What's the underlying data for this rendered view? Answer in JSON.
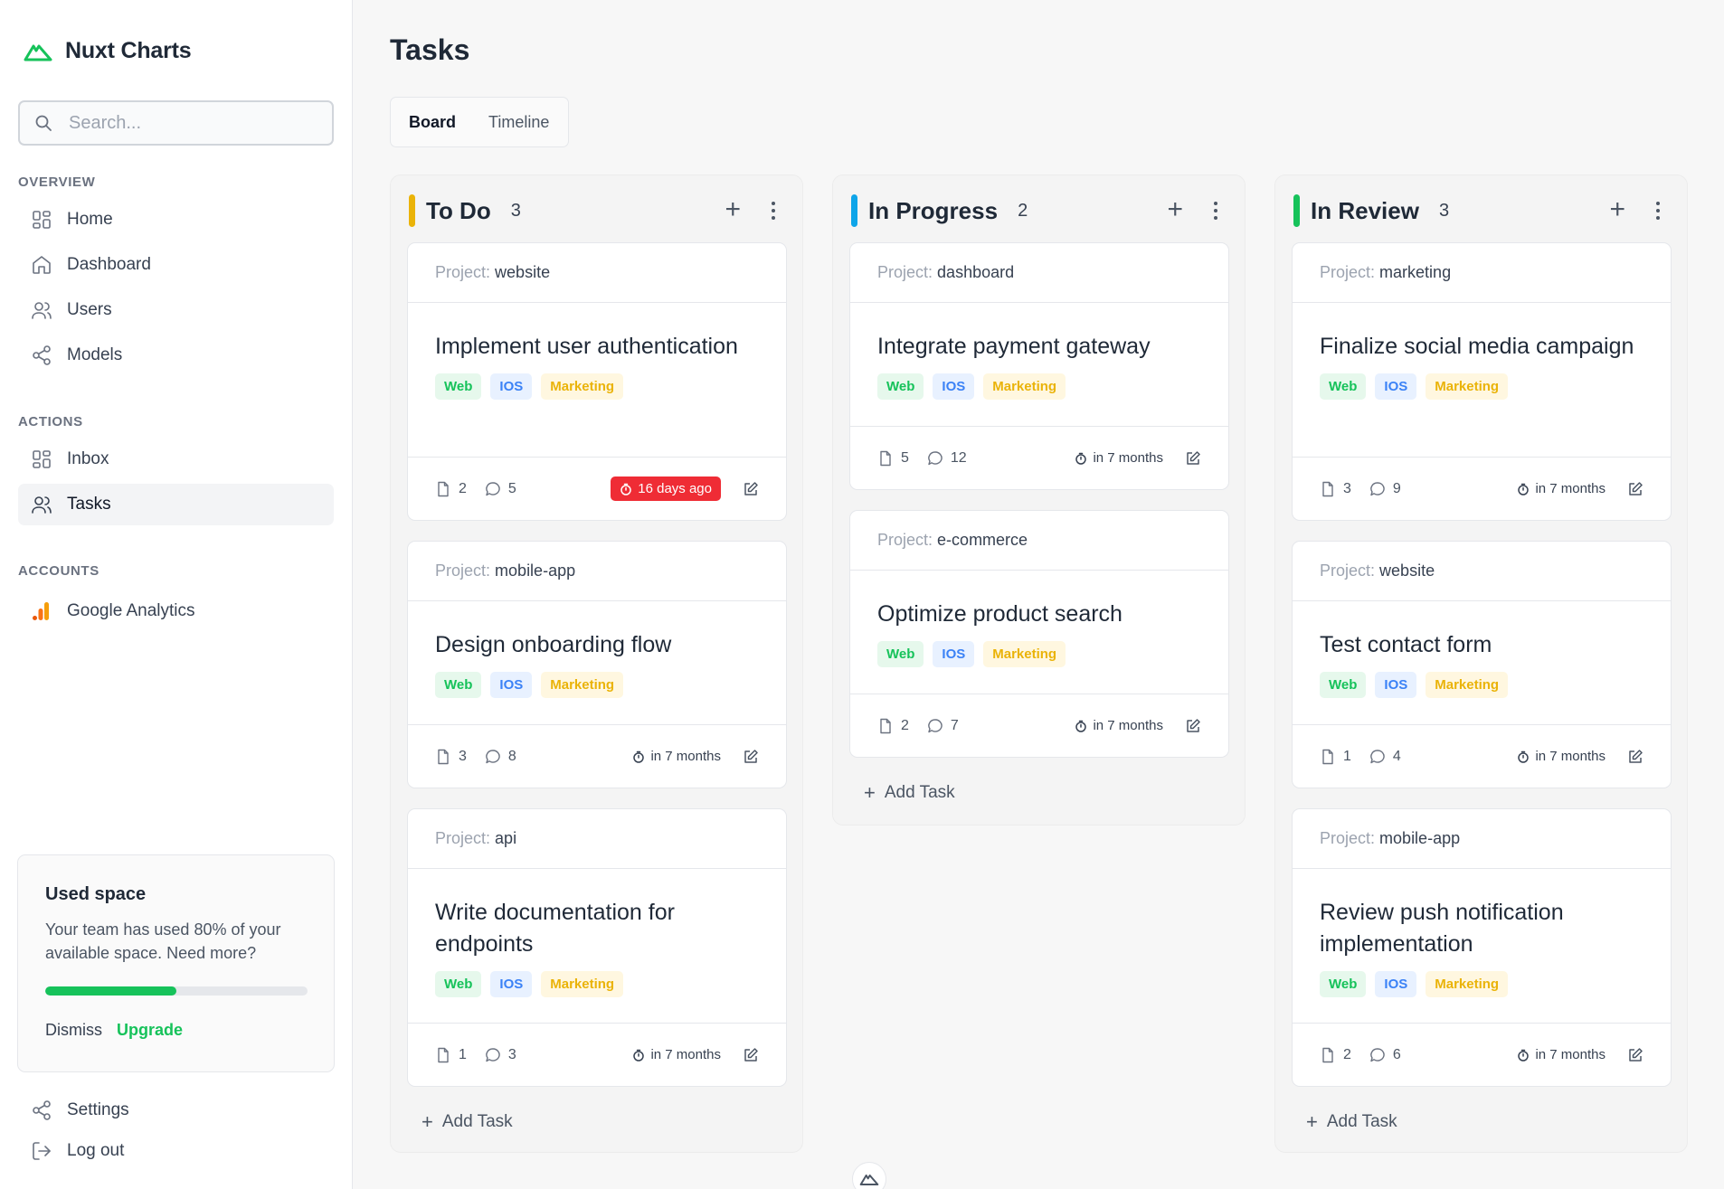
{
  "app": {
    "name": "Nuxt Charts"
  },
  "search": {
    "placeholder": "Search..."
  },
  "sidebar": {
    "overview_label": "OVERVIEW",
    "overview": [
      {
        "label": "Home",
        "icon": "grid-icon"
      },
      {
        "label": "Dashboard",
        "icon": "house-icon"
      },
      {
        "label": "Users",
        "icon": "users-icon"
      },
      {
        "label": "Models",
        "icon": "share-icon"
      }
    ],
    "actions_label": "ACTIONS",
    "actions": [
      {
        "label": "Inbox",
        "icon": "grid-icon"
      },
      {
        "label": "Tasks",
        "icon": "users-icon",
        "active": true
      }
    ],
    "accounts_label": "ACCOUNTS",
    "accounts": [
      {
        "label": "Google Analytics",
        "icon": "analytics-icon"
      }
    ],
    "usage": {
      "title": "Used space",
      "text": "Your team has used 80% of your available space. Need more?",
      "percent": 50,
      "dismiss": "Dismiss",
      "upgrade": "Upgrade"
    },
    "footer": [
      {
        "label": "Settings",
        "icon": "share-icon"
      },
      {
        "label": "Log out",
        "icon": "logout-icon"
      }
    ]
  },
  "page": {
    "title": "Tasks",
    "tabs": [
      {
        "label": "Board",
        "active": true
      },
      {
        "label": "Timeline"
      }
    ]
  },
  "board": {
    "project_prefix": "Project:",
    "add_task": "Add Task",
    "columns": [
      {
        "title": "To Do",
        "count": "3",
        "color": "#eab308",
        "cards": [
          {
            "project": "website",
            "title": "Implement user authentication",
            "tags": [
              "Web",
              "IOS",
              "Marketing"
            ],
            "files": "2",
            "comments": "5",
            "due": "16 days ago",
            "overdue": true
          },
          {
            "project": "mobile-app",
            "title": "Design onboarding flow",
            "tags": [
              "Web",
              "IOS",
              "Marketing"
            ],
            "files": "3",
            "comments": "8",
            "due": "in 7 months"
          },
          {
            "project": "api",
            "title": "Write documentation for endpoints",
            "tags": [
              "Web",
              "IOS",
              "Marketing"
            ],
            "files": "1",
            "comments": "3",
            "due": "in 7 months"
          }
        ]
      },
      {
        "title": "In Progress",
        "count": "2",
        "color": "#0ea5e9",
        "cards": [
          {
            "project": "dashboard",
            "title": "Integrate payment gateway",
            "tags": [
              "Web",
              "IOS",
              "Marketing"
            ],
            "files": "5",
            "comments": "12",
            "due": "in 7 months"
          },
          {
            "project": "e-commerce",
            "title": "Optimize product search",
            "tags": [
              "Web",
              "IOS",
              "Marketing"
            ],
            "files": "2",
            "comments": "7",
            "due": "in 7 months"
          }
        ]
      },
      {
        "title": "In Review",
        "count": "3",
        "color": "#16c25a",
        "cards": [
          {
            "project": "marketing",
            "title": "Finalize social media campaign",
            "tags": [
              "Web",
              "IOS",
              "Marketing"
            ],
            "files": "3",
            "comments": "9",
            "due": "in 7 months"
          },
          {
            "project": "website",
            "title": "Test contact form",
            "tags": [
              "Web",
              "IOS",
              "Marketing"
            ],
            "files": "1",
            "comments": "4",
            "due": "in 7 months"
          },
          {
            "project": "mobile-app",
            "title": "Review push notification implementation",
            "tags": [
              "Web",
              "IOS",
              "Marketing"
            ],
            "files": "2",
            "comments": "6",
            "due": "in 7 months"
          }
        ]
      }
    ]
  }
}
